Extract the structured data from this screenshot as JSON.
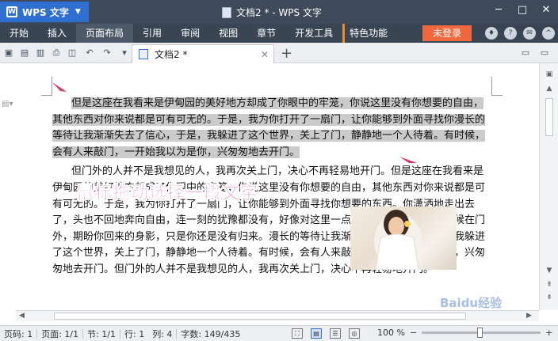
{
  "titlebar": {
    "app_name": "WPS 文字",
    "doc_title": "文档2 * - WPS 文字",
    "win_min": "─",
    "win_max": "□",
    "win_close": "✕"
  },
  "menubar": {
    "items": [
      "开始",
      "插入",
      "页面布局",
      "引用",
      "审阅",
      "视图",
      "章节",
      "开发工具",
      "特色功能"
    ],
    "active": "页面布局",
    "login": "未登录"
  },
  "toolbar": {
    "tab_label": "文档2 *",
    "add_tab": "+"
  },
  "document": {
    "para1": "但是这座在我看来是伊甸园的美好地方却成了你眼中的牢笼，你说这里没有你想要的自由，其他东西对你来说都是可有可无的。于是，我为你打开了一扇门，让你能够到外面寻找你漫长的等待让我渐渐失去了信心，于是，我躲进了这个世界，关上了门，静静地一个人待着。有时候，会有人来敲门，一开始我以为是你，兴匆匆地去开门。",
    "para2": "但门外的人并不是我想见的人，我再次关上门，决心不再轻易地开门。但是这座在我看来是伊甸园的美好地方却成了你眼中的牢笼，你说这里没有你想要的自由，其他东西对你来说都是可有可无的。于是，我为你打开了一扇门，让你能够到外面寻找你想要的东西。你潇洒地走出去了，头也不回地奔向自由，连一刻的犹豫都没有，好像对这里一点留恋都没有。我每天守候在门外，期盼你回来的身影，只是你还是没有归来。漫长的等待让我渐渐失去了信心，于是，我躲进了这个世界，关上了门，静静地一个人待着。有时候，会有人来敲门，一开始我以为是你，兴匆匆地去开门。但门外的人并不是我想见的人，我再次关上门，决心不再轻易地开门。",
    "overlay_caption": "鼠标拖动选择一段文字"
  },
  "statusbar": {
    "page_no": "页码: 1",
    "pages": "页面: 1/1",
    "section": "节: 1/1",
    "line": "行: 1",
    "column": "列: 4",
    "words": "字数: 149/435",
    "zoom": "100 %",
    "zoom_percent": 100
  },
  "watermark": "Baidu经验"
}
